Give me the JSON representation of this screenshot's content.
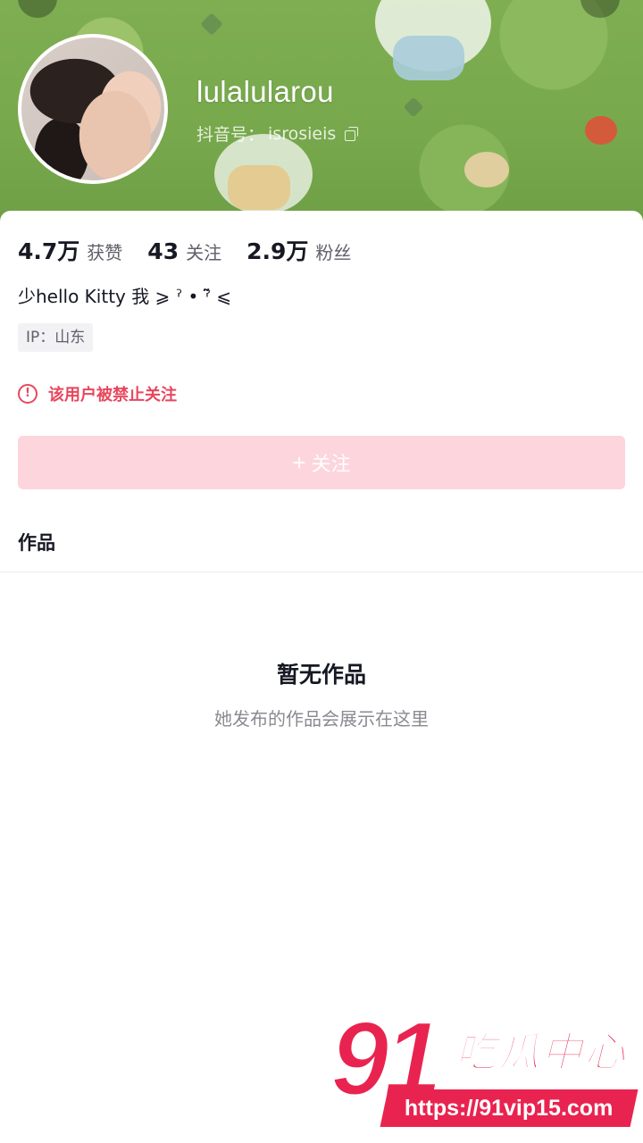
{
  "profile": {
    "username": "lulalularou",
    "douyin_id_label": "抖音号：",
    "douyin_id": "isrosieis"
  },
  "stats": [
    {
      "value": "4.7万",
      "label": "获赞"
    },
    {
      "value": "43",
      "label": "关注"
    },
    {
      "value": "2.9万",
      "label": "粉丝"
    }
  ],
  "bio": "少hello Kitty 我 ⩾ ˀ • ˀ̃̈ ⩽",
  "ip_tag": "IP：山东",
  "banned_notice": {
    "icon": "!",
    "text": "该用户被禁止关注"
  },
  "follow_button": {
    "icon": "+",
    "label": "关注"
  },
  "tabs": {
    "works": "作品"
  },
  "empty_state": {
    "title": "暂无作品",
    "subtitle": "她发布的作品会展示在这里"
  },
  "watermark": {
    "number": "91",
    "name": "吃瓜中心",
    "url": "https://91vip15.com"
  },
  "colors": {
    "accent": "#e8475c",
    "follow_disabled": "#fdd5dd",
    "banner_green": "#7fae52"
  }
}
